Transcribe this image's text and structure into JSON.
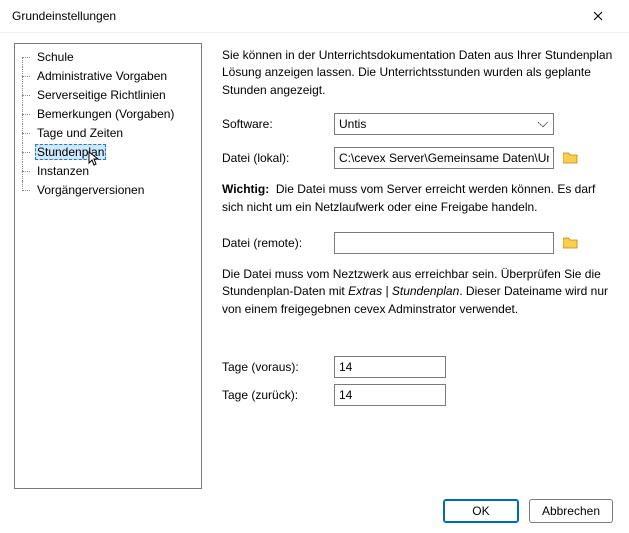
{
  "window": {
    "title": "Grundeinstellungen"
  },
  "tree": {
    "items": [
      {
        "label": "Schule"
      },
      {
        "label": "Administrative Vorgaben"
      },
      {
        "label": "Serverseitige Richtlinien"
      },
      {
        "label": "Bemerkungen (Vorgaben)"
      },
      {
        "label": "Tage und Zeiten"
      },
      {
        "label": "Stundenplan",
        "selected": true
      },
      {
        "label": "Instanzen"
      },
      {
        "label": "Vorgängerversionen"
      }
    ]
  },
  "intro": "Sie können in der Unterrichtsdokumentation Daten aus Ihrer Stundenplan Lösung anzeigen lassen. Die Unterrichtsstunden wurden als geplante Stunden angezeigt.",
  "software": {
    "label": "Software:",
    "value": "Untis"
  },
  "file_local": {
    "label": "Datei (lokal):",
    "value": "C:\\cevex Server\\Gemeinsame Daten\\Untis\\S"
  },
  "warn": {
    "prefix": "Wichtig:",
    "text": "Die Datei muss vom Server erreicht werden können. Es darf sich nicht um ein Netzlaufwerk oder eine Freigabe handeln."
  },
  "file_remote": {
    "label": "Datei (remote):",
    "value": ""
  },
  "note": {
    "pre": "Die Datei muss vom Neztzwerk aus erreichbar sein. Überprüfen Sie die Stundenplan-Daten mit ",
    "em": "Extras | Stundenplan",
    "post": ". Dieser Dateiname wird nur von einem freigegebnen cevex Adminstrator verwendet."
  },
  "days_fwd": {
    "label": "Tage (voraus):",
    "value": "14"
  },
  "days_back": {
    "label": "Tage (zurück):",
    "value": "14"
  },
  "buttons": {
    "ok": "OK",
    "cancel": "Abbrechen"
  }
}
